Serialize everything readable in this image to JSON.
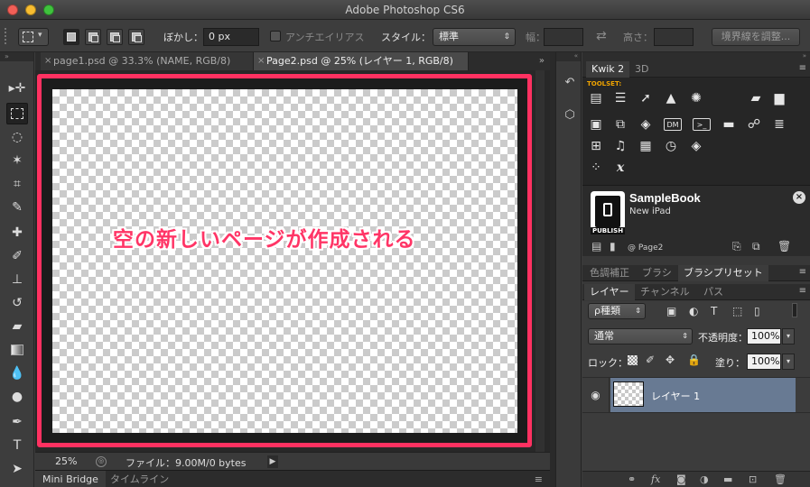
{
  "app": {
    "title": "Adobe Photoshop CS6"
  },
  "options_bar": {
    "feather_label": "ぼかし：",
    "feather_value": "0 px",
    "antialias_label": "アンチエイリアス",
    "style_label": "スタイル：",
    "style_value": "標準",
    "width_label": "幅：",
    "height_label": "高さ：",
    "refine_edge_label": "境界線を調整..."
  },
  "document_tabs": [
    {
      "label": "page1.psd @ 33.3% (NAME, RGB/8)",
      "active": false
    },
    {
      "label": "Page2.psd @ 25% (レイヤー 1, RGB/8)",
      "active": true
    }
  ],
  "canvas": {
    "annotation": "空の新しいページが作成される",
    "annotation_color": "#ff3161"
  },
  "status_bar": {
    "zoom": "25%",
    "file_info": "ファイル：9.00M/0 bytes"
  },
  "bottom_tabs": [
    {
      "label": "Mini Bridge",
      "active": true
    },
    {
      "label": "タイムライン",
      "active": false
    }
  ],
  "kwik_panel": {
    "tabs": [
      {
        "label": "Kwik 2",
        "active": true
      },
      {
        "label": "3D",
        "active": false
      }
    ],
    "toolset_label": "TOOLSET:",
    "icons": [
      "page-icon",
      "list-icon",
      "pointer-icon",
      "rocket-icon",
      "atom-icon",
      "add-folder-icon",
      "folder-icon",
      "image-icon",
      "dragdrop-icon",
      "move-icon",
      "dm-icon",
      "console-icon",
      "card-icon",
      "chat-icon",
      "stack-icon",
      "add-icon",
      "music-icon",
      "video-icon",
      "timer-icon",
      "layers-icon",
      "loader-icon",
      "variable-icon"
    ],
    "publish": {
      "project_name": "SampleBook",
      "device": "New iPad",
      "publish_label": "PUBLISH",
      "page_label": "@ Page2"
    }
  },
  "adjust_tabs": [
    {
      "label": "色調補正",
      "active": false
    },
    {
      "label": "ブラシ",
      "active": false
    },
    {
      "label": "ブラシプリセット",
      "active": true
    }
  ],
  "layer_tabs": [
    {
      "label": "レイヤー",
      "active": true
    },
    {
      "label": "チャンネル",
      "active": false
    },
    {
      "label": "パス",
      "active": false
    }
  ],
  "layers_panel": {
    "filter_label": "ρ種類",
    "blend_mode": "通常",
    "opacity_label": "不透明度：",
    "opacity_value": "100%",
    "lock_label": "ロック：",
    "fill_label": "塗り：",
    "fill_value": "100%",
    "layers": [
      {
        "name": "レイヤー 1",
        "selected": true,
        "visible": true
      }
    ],
    "selected_color": "#687a93"
  }
}
